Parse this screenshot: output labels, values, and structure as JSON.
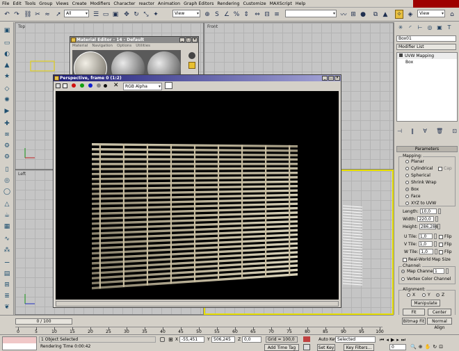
{
  "menu": [
    "File",
    "Edit",
    "Tools",
    "Group",
    "Views",
    "Create",
    "Modifiers",
    "Character",
    "reactor",
    "Animation",
    "Graph Editors",
    "Rendering",
    "Customize",
    "MAXScript",
    "Help"
  ],
  "toolbar": {
    "filter": "All",
    "refcoord": "View",
    "named_sel": "",
    "view2": "View"
  },
  "viewports": {
    "top": "Top",
    "front": "Front",
    "left": "Left"
  },
  "material_editor": {
    "title": "Material Editor - 14 - Default",
    "menu": [
      "Material",
      "Navigation",
      "Options",
      "Utilities"
    ]
  },
  "render_window": {
    "title": "Perspective, frame 0 (1:2)",
    "channel": "RGB Alpha"
  },
  "command_panel": {
    "object_name": "Box01",
    "modifier_list": "Modifier List",
    "stack": [
      "UVW Mapping",
      "Box"
    ],
    "rollout": "Parameters",
    "mapping_title": "Mapping:",
    "mapping_options": [
      "Planar",
      "Cylindrical",
      "Spherical",
      "Shrink Wrap",
      "Box",
      "Face",
      "XYZ to UVW"
    ],
    "mapping_selected": "Box",
    "cap_label": "Cap",
    "length_label": "Length:",
    "length": "10,0",
    "width_label": "Width:",
    "width": "220,0",
    "height_label": "Height:",
    "height": "286,286",
    "utile_label": "U Tile:",
    "utile": "1,0",
    "vtile_label": "V Tile:",
    "vtile": "1,0",
    "wtile_label": "W Tile:",
    "wtile": "1,0",
    "flip_label": "Flip",
    "realworld_label": "Real-World Map Size",
    "channel_title": "Channel:",
    "map_channel_label": "Map Channel:",
    "map_channel": "1",
    "vertex_color_label": "Vertex Color Channel",
    "alignment_title": "Alignment:",
    "axes": [
      "X",
      "Y",
      "Z"
    ],
    "axis_selected": "Z",
    "manipulate": "Manipulate",
    "fit": "Fit",
    "center": "Center",
    "bitmap_fit": "Bitmap Fit",
    "normal_align": "Normal Align"
  },
  "timeline": {
    "slider": "0 / 100",
    "ticks": [
      "0",
      "5",
      "10",
      "15",
      "20",
      "25",
      "30",
      "35",
      "40",
      "45",
      "50",
      "55",
      "60",
      "65",
      "70",
      "75",
      "80",
      "85",
      "90",
      "95",
      "100"
    ]
  },
  "status": {
    "selection": "1 Object Selected",
    "render_time": "Rendering Time  0:00:42",
    "x_label": "X",
    "x": "-55,451",
    "y_label": "Y",
    "y": "506,245",
    "z_label": "Z",
    "z": "0,0",
    "grid": "Grid = 100,0",
    "add_time_tag": "Add Time Tag",
    "auto_key": "Auto Key",
    "selected": "Selected",
    "set_key": "Set Key",
    "key_filters": "Key Filters...",
    "frame": "0"
  },
  "colors": {
    "menu_redbar": "#9e0000",
    "render_title_start": "#1c1c78",
    "render_title_end": "#a6a6d8",
    "matwin_title": "#8a8a8a",
    "active_viewport": "#e8e000"
  }
}
